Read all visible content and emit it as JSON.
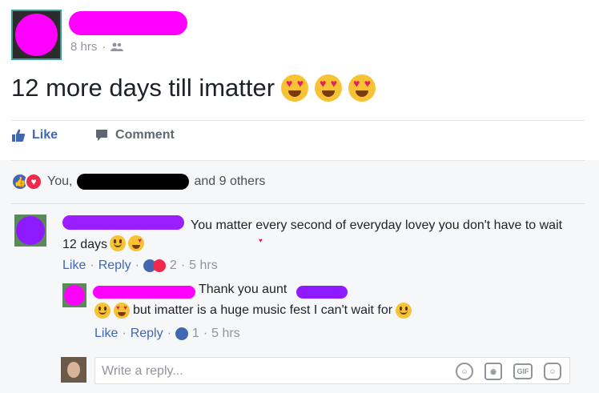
{
  "post": {
    "time": "8 hrs",
    "separator": "·",
    "text": "12 more days till imatter"
  },
  "actions": {
    "like": "Like",
    "comment": "Comment"
  },
  "reactions": {
    "you": "You,",
    "others": "and 9 others"
  },
  "comment1": {
    "text": "You matter every second of everyday lovey you don't have to wait 12 days",
    "like": "Like",
    "reply": "Reply",
    "reaction_count": "2",
    "time": "5 hrs"
  },
  "reply1": {
    "text_a": "Thank you aunt",
    "text_b": "but imatter is a huge music fest I can't wait for",
    "like": "Like",
    "reply": "Reply",
    "reaction_count": "1",
    "time": "5 hrs"
  },
  "reply_box": {
    "placeholder": "Write a reply...",
    "icons": [
      "emoji-icon",
      "camera-icon",
      "gif-icon",
      "sticker-icon"
    ],
    "gif_label": "GIF"
  },
  "colors": {
    "accent": "#4267b2",
    "love": "#f0284a",
    "redact_pink": "#ff00ff",
    "redact_purple": "#8e1bff"
  }
}
